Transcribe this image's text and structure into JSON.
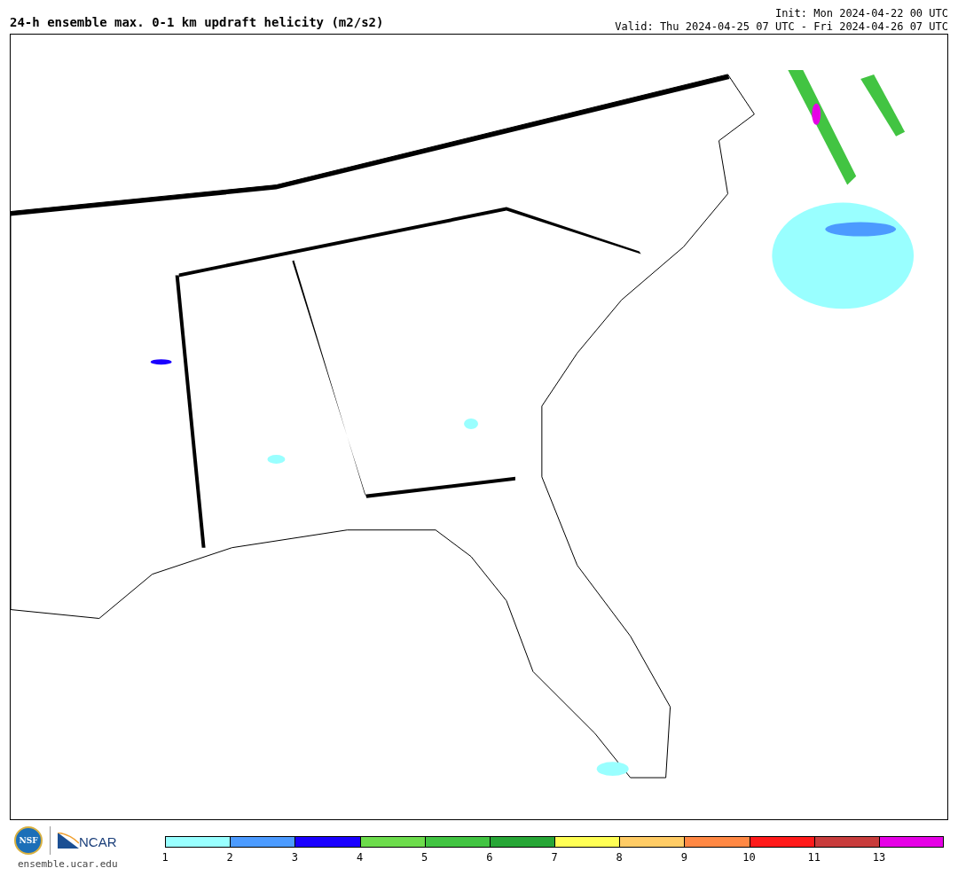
{
  "title": "24-h ensemble max. 0-1 km updraft helicity (m2/s2)",
  "init": "Init: Mon 2024-04-22 00 UTC",
  "valid": "Valid: Thu 2024-04-25 07 UTC - Fri 2024-04-26 07 UTC",
  "logos": {
    "nsf": "NSF",
    "ncar": "NCAR",
    "url": "ensemble.ucar.edu"
  },
  "colorbar": [
    {
      "color": "#99ffff",
      "label": "1"
    },
    {
      "color": "#4c9bff",
      "label": "2"
    },
    {
      "color": "#1a00ff",
      "label": "3"
    },
    {
      "color": "#6ddc4c",
      "label": "4"
    },
    {
      "color": "#42c442",
      "label": "5"
    },
    {
      "color": "#27a636",
      "label": "6"
    },
    {
      "color": "#ffff55",
      "label": "7"
    },
    {
      "color": "#ffcc66",
      "label": "8"
    },
    {
      "color": "#ff8844",
      "label": "9"
    },
    {
      "color": "#ff1a1a",
      "label": "10"
    },
    {
      "color": "#c83c3c",
      "label": "11"
    },
    {
      "color": "#e600e6",
      "label": "13"
    }
  ]
}
